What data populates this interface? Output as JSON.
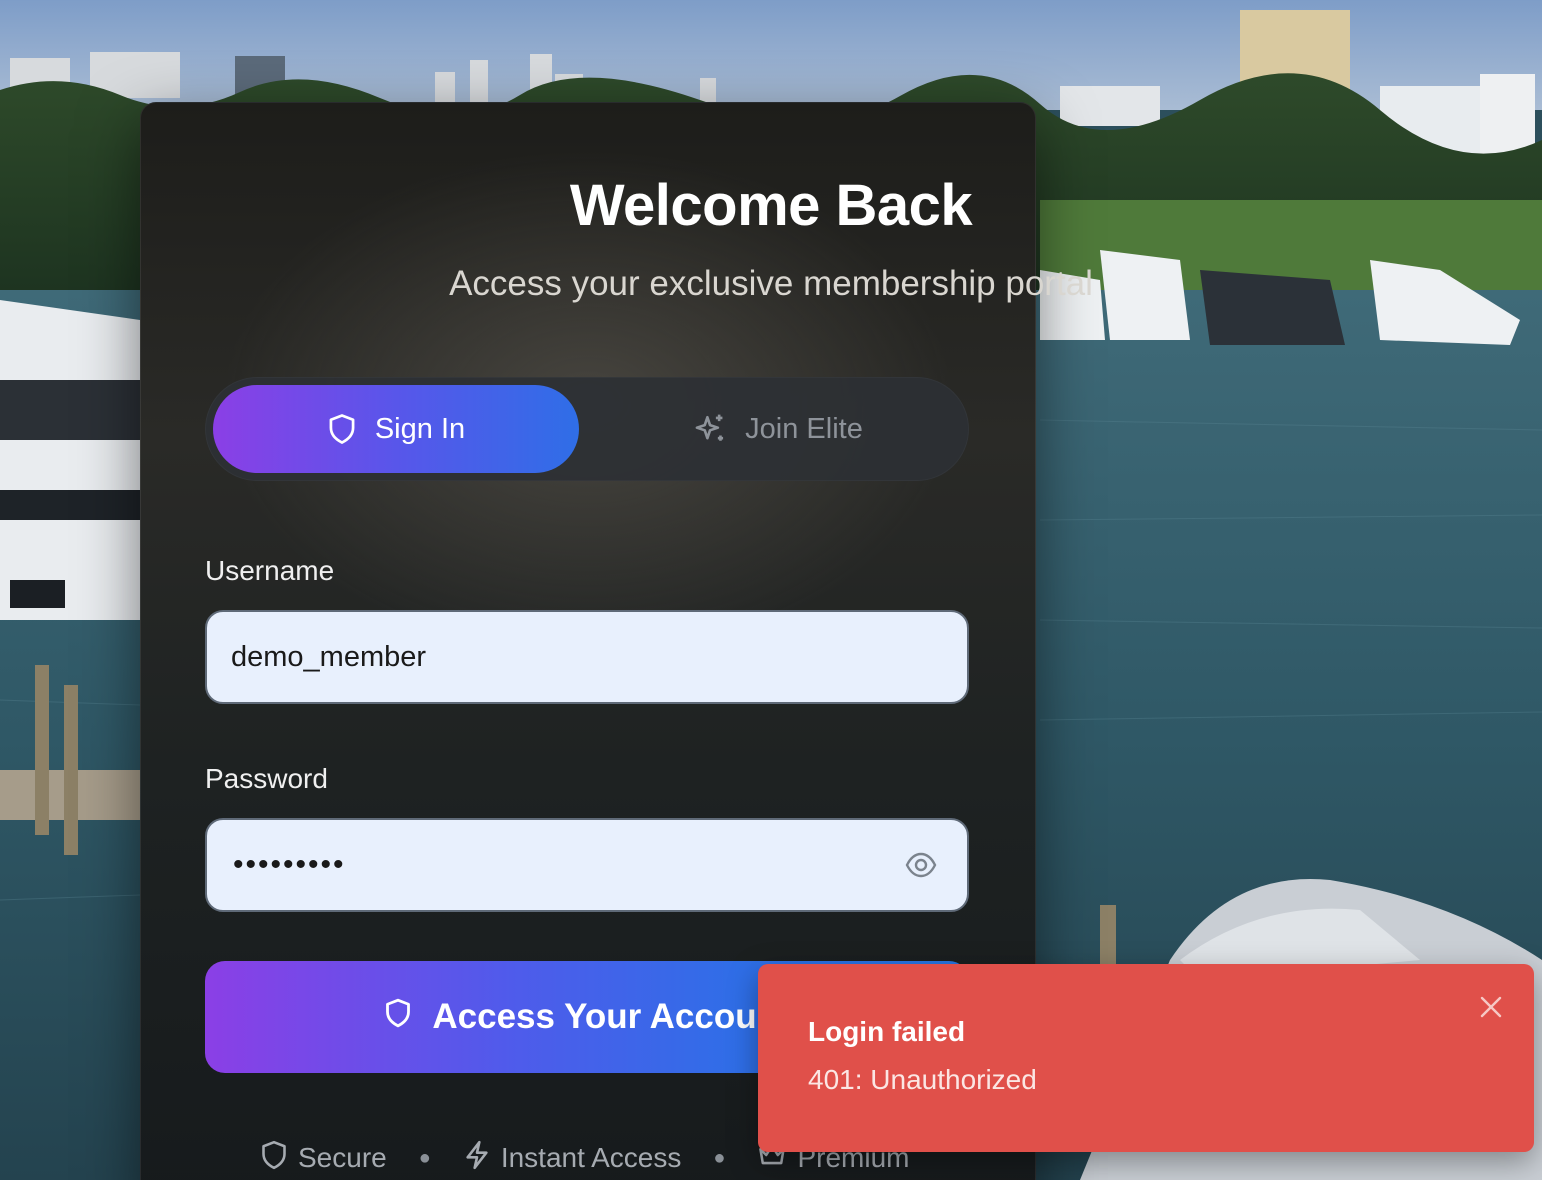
{
  "background": {
    "description_icon": "marina-photo-background"
  },
  "card": {
    "title": "Welcome Back",
    "subtitle": "Access your exclusive membership portal"
  },
  "tabs": [
    {
      "label": "Sign In",
      "icon": "shield-icon",
      "active": true
    },
    {
      "label": "Join Elite",
      "icon": "sparkles-icon",
      "active": false
    }
  ],
  "form": {
    "username_label": "Username",
    "username_value": "demo_member",
    "password_label": "Password",
    "password_masked": "•••••••••",
    "submit_label": "Access Your Account"
  },
  "features": [
    {
      "label": "Secure",
      "icon": "shield-icon"
    },
    {
      "label": "Instant Access",
      "icon": "lightning-icon"
    },
    {
      "label": "Premium",
      "icon": "crown-icon"
    }
  ],
  "toast": {
    "title": "Login failed",
    "message": "401: Unauthorized"
  },
  "colors": {
    "accent_start": "#8b3fe6",
    "accent_end": "#2f6ee7",
    "error": "#e0504a",
    "field_bg": "#e8f0fd"
  }
}
